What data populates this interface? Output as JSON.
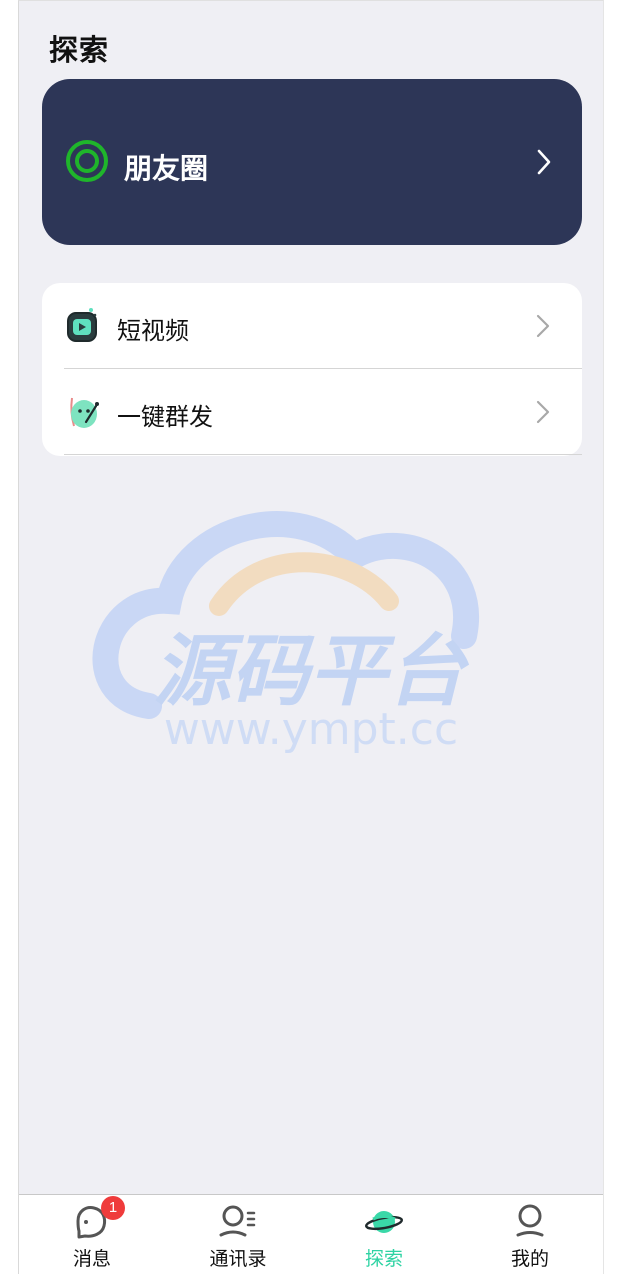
{
  "page": {
    "title": "探索"
  },
  "moments": {
    "label": "朋友圈",
    "icon": "moments-ring-icon",
    "accent": "#1fb52b",
    "card_color": "#2d3657"
  },
  "list": {
    "items": [
      {
        "label": "短视频",
        "icon": "short-video-icon"
      },
      {
        "label": "一键群发",
        "icon": "broadcast-icon"
      }
    ]
  },
  "watermark": {
    "text": "源码平台",
    "url": "www.ympt.cc"
  },
  "tabbar": {
    "tabs": [
      {
        "label": "消息",
        "icon": "chat-bubble-icon",
        "badge": "1"
      },
      {
        "label": "通讯录",
        "icon": "contacts-icon"
      },
      {
        "label": "探索",
        "icon": "planet-icon",
        "active": true
      },
      {
        "label": "我的",
        "icon": "profile-icon"
      }
    ],
    "active_color": "#2ed3a3"
  }
}
